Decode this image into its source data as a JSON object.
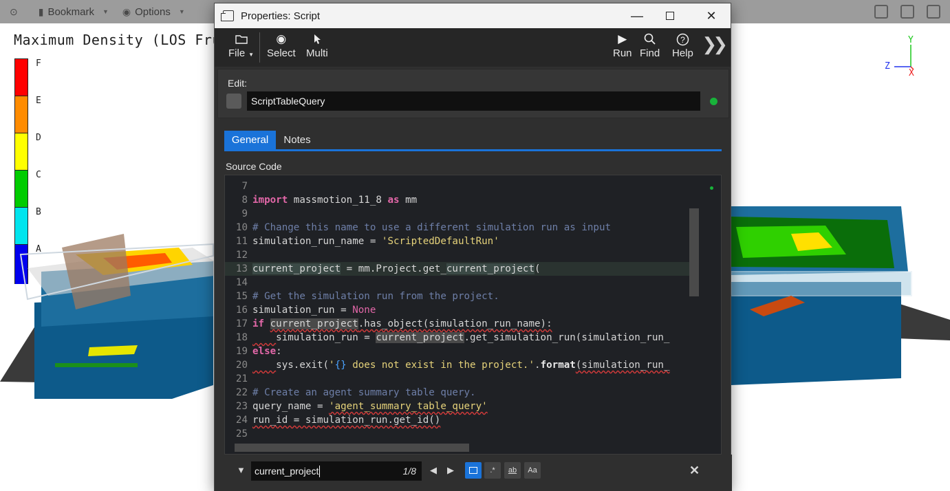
{
  "background_app": {
    "toolbar": [
      {
        "label": "",
        "icon": "target-icon"
      },
      {
        "label": "Bookmark",
        "icon": "bookmark-icon"
      },
      {
        "label": "Options",
        "icon": "eye-icon"
      }
    ],
    "viewport_title": "Maximum Density (LOS Fru",
    "legend": [
      {
        "label": "F",
        "color": "#ff0000"
      },
      {
        "label": "E",
        "color": "#ff8c00"
      },
      {
        "label": "D",
        "color": "#ffff00"
      },
      {
        "label": "C",
        "color": "#00cc00"
      },
      {
        "label": "B",
        "color": "#00e5ee"
      },
      {
        "label": "A",
        "color": "#0000ee"
      }
    ],
    "axes": {
      "y": "Y",
      "z": "Z",
      "x": "X"
    }
  },
  "dialog": {
    "title": "Properties: Script",
    "toolbar": {
      "file": "File",
      "select": "Select",
      "multi": "Multi",
      "run": "Run",
      "find": "Find",
      "help": "Help"
    },
    "edit": {
      "label": "Edit:",
      "name_value": "ScriptTableQuery"
    },
    "tabs": {
      "general": "General",
      "notes": "Notes"
    },
    "source_label": "Source Code",
    "find": {
      "query": "current_project",
      "count": "1/8",
      "options": {
        "regex": ".*",
        "word": "ab",
        "case": "Aa"
      }
    }
  },
  "code_lines": [
    {
      "n": "7"
    },
    {
      "n": "8"
    },
    {
      "n": "9"
    },
    {
      "n": "10"
    },
    {
      "n": "11"
    },
    {
      "n": "12"
    },
    {
      "n": "13"
    },
    {
      "n": "14"
    },
    {
      "n": "15"
    },
    {
      "n": "16"
    },
    {
      "n": "17"
    },
    {
      "n": "18"
    },
    {
      "n": "19"
    },
    {
      "n": "20"
    },
    {
      "n": "21"
    },
    {
      "n": "22"
    },
    {
      "n": "23"
    },
    {
      "n": "24"
    },
    {
      "n": "25"
    }
  ],
  "code": {
    "l8": {
      "kw1": "import",
      "mid": " massmotion_11_8 ",
      "kw2": "as",
      "end": " mm"
    },
    "l10": "# Change this name to use a different simulation run as input",
    "l11": {
      "a": "simulation_run_name = ",
      "s": "'ScriptedDefaultRun'"
    },
    "l13": {
      "a": "current_project",
      "b": " = mm.Project.get_",
      "c": "current_project",
      "d": "("
    },
    "l15": "# Get the simulation run from the project.",
    "l16": {
      "a": "simulation_run = ",
      "n": "None"
    },
    "l17": {
      "kw": "if",
      "sp": " ",
      "a": "current_project",
      "b": ".has_object(simulation_run_name):"
    },
    "l18": {
      "ind": "    ",
      "a": "simulation_run = ",
      "b": "current_project",
      "c": ".get_simulation_run(simulation_run_"
    },
    "l19": {
      "kw": "else",
      "c": ":"
    },
    "l20": {
      "ind": "    ",
      "a": "sys.exit(",
      "s1": "'",
      "br": "{}",
      "s2": " does not exist in the project.'",
      "dot": ".",
      "fmt": "format",
      "end": "(simulation_run_"
    },
    "l22": "# Create an agent summary table query.",
    "l23": {
      "a": "query_name = ",
      "s": "'agent_summary_table_query'"
    },
    "l24": "run_id = simulation_run.get_id()"
  }
}
